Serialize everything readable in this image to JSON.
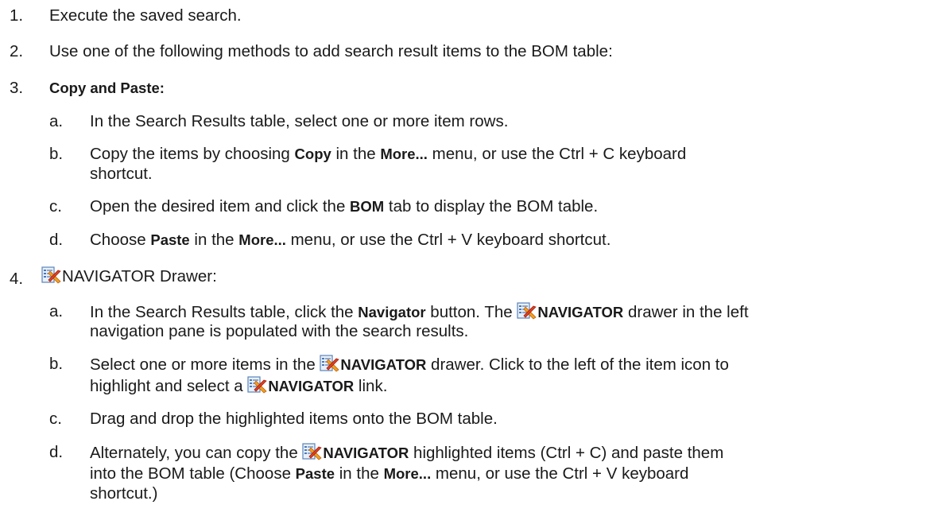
{
  "steps": {
    "s1": {
      "num": "1.",
      "text": "Execute the saved search."
    },
    "s2": {
      "num": "2.",
      "text": "Use one of the following methods to add search result items to the BOM table:"
    },
    "s3": {
      "num": "3.",
      "title": "Copy and Paste:",
      "a": {
        "num": "a.",
        "text": "In the Search Results table, select one or more item rows."
      },
      "b": {
        "num": "b.",
        "t1": "Copy the items by choosing ",
        "bold1": "Copy",
        "t2": " in the ",
        "bold2": "More...",
        "t3": " menu, or use the Ctrl + C keyboard",
        "t4": "shortcut."
      },
      "c": {
        "num": "c.",
        "t1": "Open the desired item and click the ",
        "bold1": "BOM",
        "t2": " tab to display the BOM table."
      },
      "d": {
        "num": "d.",
        "t1": "Choose ",
        "bold1": "Paste",
        "t2": " in the ",
        "bold2": "More...",
        "t3": " menu, or use the Ctrl + V keyboard shortcut."
      }
    },
    "s4": {
      "num": "4.",
      "title": "NAVIGATOR Drawer:",
      "a": {
        "num": "a.",
        "t1": "In the Search Results table, click the ",
        "bold1": "Navigator",
        "t2": " button. The ",
        "bold2": "NAVIGATOR",
        "t3": " drawer in the left",
        "t4": "navigation pane is populated with the search results."
      },
      "b": {
        "num": "b.",
        "t1": "Select one or more items in the ",
        "bold1": "NAVIGATOR",
        "t2": " drawer. Click to the left of the item icon to",
        "t3": "highlight and select a ",
        "bold2": "NAVIGATOR",
        "t4": " link."
      },
      "c": {
        "num": "c.",
        "text": "Drag and drop the highlighted items onto the BOM table."
      },
      "d": {
        "num": "d.",
        "t1": "Alternately, you can copy the ",
        "bold1": "NAVIGATOR",
        "t2": " highlighted items (Ctrl + C) and paste them",
        "t3": "into the BOM table (Choose ",
        "bold2": "Paste",
        "t4": " in the ",
        "bold3": "More...",
        "t5": " menu, or use the Ctrl + V keyboard",
        "t6": "shortcut.)"
      }
    }
  },
  "icons": {
    "navigator": "navigator-icon"
  }
}
